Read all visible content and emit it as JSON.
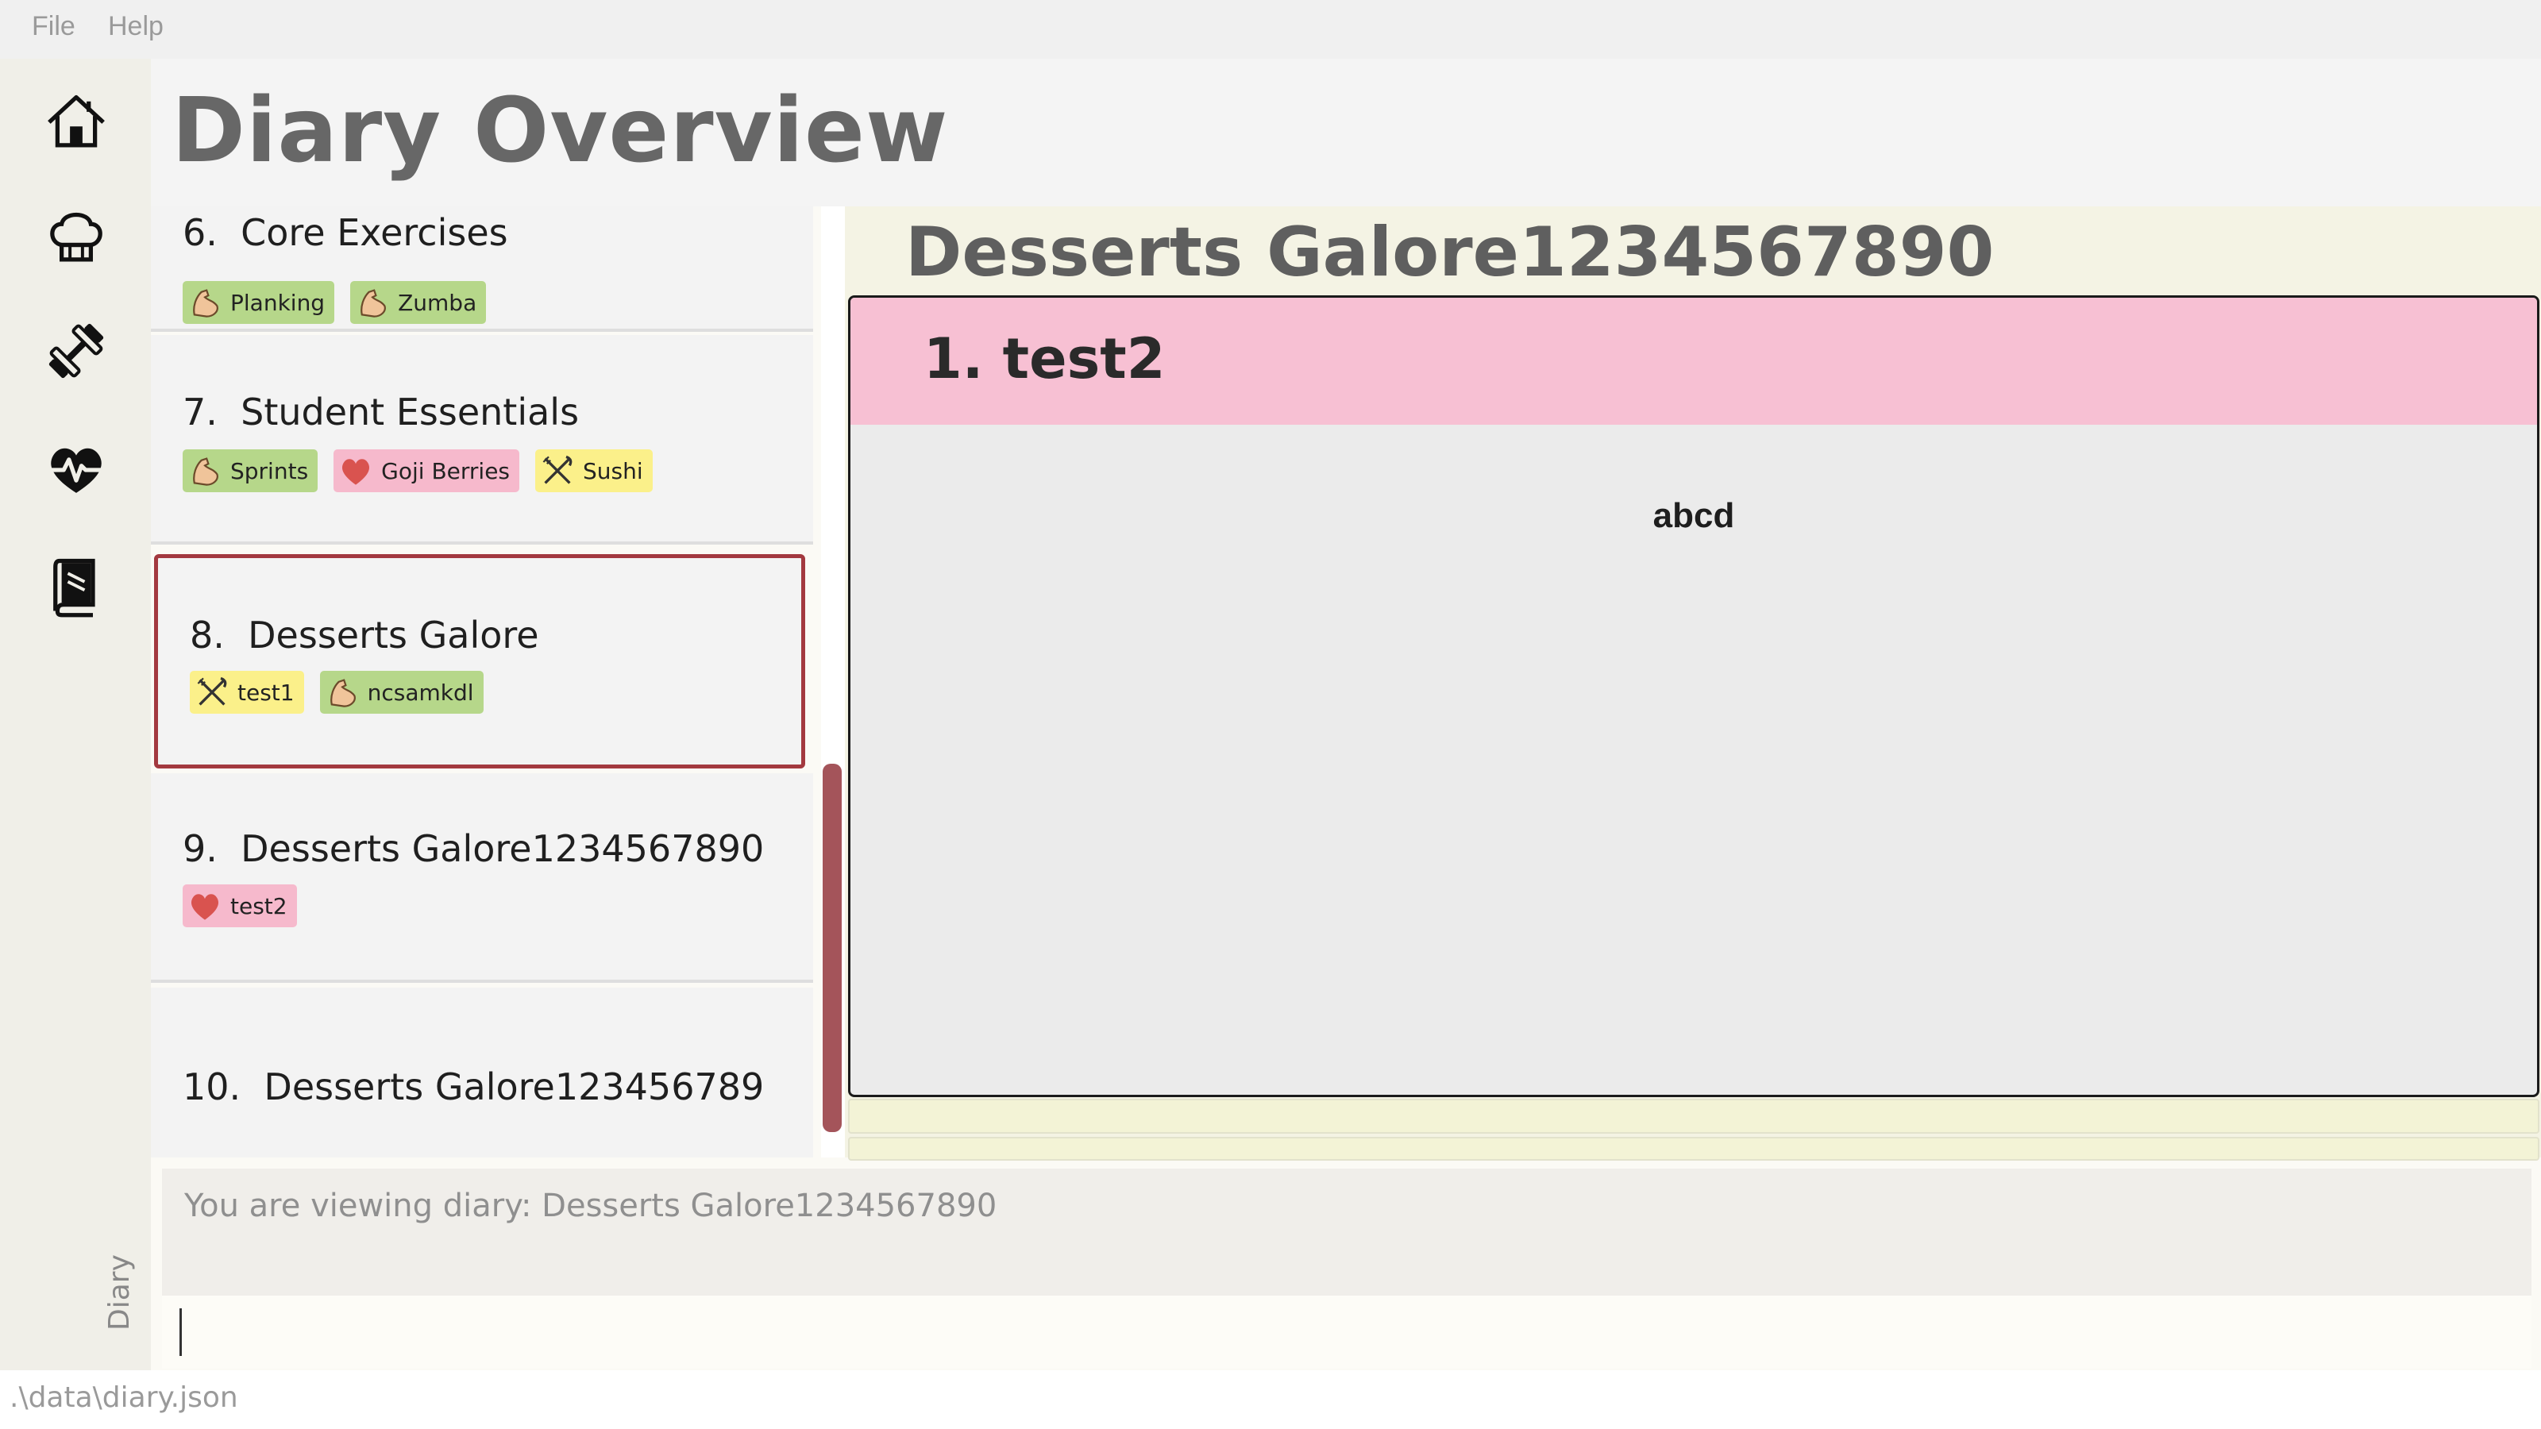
{
  "menu": {
    "file_label": "File",
    "help_label": "Help"
  },
  "sidebar": {
    "items": [
      {
        "name": "home",
        "icon": "home-icon"
      },
      {
        "name": "recipes",
        "icon": "chef-hat-icon"
      },
      {
        "name": "exercises",
        "icon": "dumbbell-icon"
      },
      {
        "name": "health",
        "icon": "heartbeat-icon"
      },
      {
        "name": "diary",
        "icon": "book-icon"
      }
    ],
    "tab_label": "Diary"
  },
  "header": {
    "title": "Diary Overview"
  },
  "diary_list": [
    {
      "index": "6.",
      "title": "Core Exercises",
      "tags": [
        {
          "label": "Planking",
          "kind": "exercise"
        },
        {
          "label": "Zumba",
          "kind": "exercise"
        }
      ]
    },
    {
      "index": "7.",
      "title": "Student Essentials",
      "tags": [
        {
          "label": "Sprints",
          "kind": "exercise"
        },
        {
          "label": "Goji Berries",
          "kind": "health"
        },
        {
          "label": "Sushi",
          "kind": "recipe"
        }
      ]
    },
    {
      "index": "8.",
      "title": "Desserts Galore",
      "selected": true,
      "tags": [
        {
          "label": "test1",
          "kind": "recipe"
        },
        {
          "label": "ncsamkdl",
          "kind": "exercise"
        }
      ]
    },
    {
      "index": "9.",
      "title": "Desserts Galore1234567890",
      "tags": [
        {
          "label": "test2",
          "kind": "health"
        }
      ]
    },
    {
      "index": "10.",
      "title": "Desserts Galore123456789",
      "tags": []
    }
  ],
  "detail": {
    "title": "Desserts Galore1234567890",
    "entry": {
      "title": "1. test2",
      "body": "abcd"
    }
  },
  "result": {
    "text": "You are viewing diary: Desserts Galore1234567890"
  },
  "command": {
    "value": ""
  },
  "status": {
    "path": ".\\data\\diary.json"
  },
  "colors": {
    "exercise_tag": "#b6d78a",
    "health_tag": "#f6b9cc",
    "recipe_tag": "#fbf08a",
    "selected_border": "#a3393f",
    "entry_header": "#f7c0d3"
  }
}
